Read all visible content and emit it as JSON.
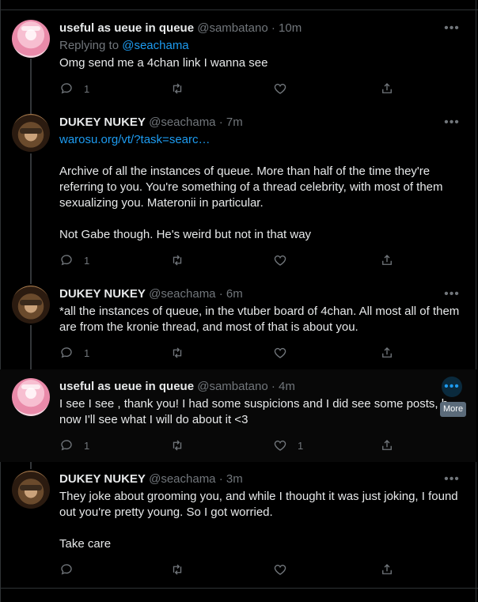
{
  "colors": {
    "background": "#000000",
    "accent": "#1d9bf0",
    "muted": "#71767b",
    "text": "#e7e9ea"
  },
  "tweets": [
    {
      "name": "useful as ueue in queue",
      "handle": "@sambatano",
      "time": "· 10m",
      "reply_label": "Replying to",
      "reply_handle": "@seachama",
      "body": "Omg send me a 4chan link I wanna see",
      "counts": {
        "reply": "1",
        "like": ""
      }
    },
    {
      "name": "DUKEY NUKEY",
      "handle": "@seachama",
      "time": "· 7m",
      "link": "warosu.org/vt/?task=searc…",
      "body_p1": "Archive of all the instances of queue. More than half of the time they're referring to you. You're something of a thread celebrity, with most of them sexualizing you. Materonii in particular.",
      "body_p2": "Not Gabe though. He's weird but not in that way",
      "counts": {
        "reply": "1",
        "like": ""
      }
    },
    {
      "name": "DUKEY NUKEY",
      "handle": "@seachama",
      "time": "· 6m",
      "body": "*all the instances of queue, in the vtuber board of 4chan. All most all of them are from the kronie thread, and most of that is about you.",
      "counts": {
        "reply": "1",
        "like": ""
      }
    },
    {
      "name": "useful as ueue in queue",
      "handle": "@sambatano",
      "time": "· 4m",
      "body_line1": "I see I see , thank you! I had some suspicions and I did see some posts, b",
      "body_line2": "now I'll see what I will do about it <3",
      "counts": {
        "reply": "1",
        "like": "1"
      },
      "tooltip": "More"
    },
    {
      "name": "DUKEY NUKEY",
      "handle": "@seachama",
      "time": "· 3m",
      "body_p1": "They joke about grooming you, and while I thought it was just joking, I found out you're pretty young. So I got worried.",
      "body_p2": "Take care",
      "counts": {
        "reply": "",
        "like": ""
      }
    }
  ],
  "icons": [
    "more-icon",
    "reply-icon",
    "retweet-icon",
    "like-icon",
    "share-icon"
  ]
}
